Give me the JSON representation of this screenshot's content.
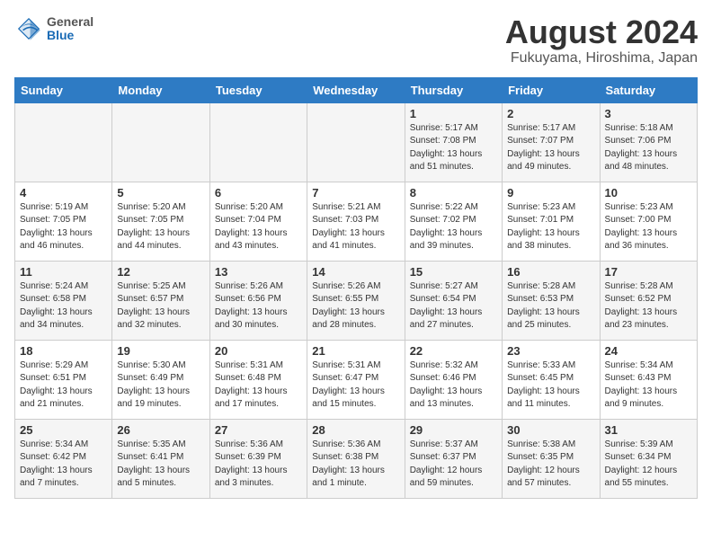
{
  "header": {
    "logo_general": "General",
    "logo_blue": "Blue",
    "month_year": "August 2024",
    "location": "Fukuyama, Hiroshima, Japan"
  },
  "days_of_week": [
    "Sunday",
    "Monday",
    "Tuesday",
    "Wednesday",
    "Thursday",
    "Friday",
    "Saturday"
  ],
  "weeks": [
    [
      {
        "day": "",
        "info": ""
      },
      {
        "day": "",
        "info": ""
      },
      {
        "day": "",
        "info": ""
      },
      {
        "day": "",
        "info": ""
      },
      {
        "day": "1",
        "info": "Sunrise: 5:17 AM\nSunset: 7:08 PM\nDaylight: 13 hours\nand 51 minutes."
      },
      {
        "day": "2",
        "info": "Sunrise: 5:17 AM\nSunset: 7:07 PM\nDaylight: 13 hours\nand 49 minutes."
      },
      {
        "day": "3",
        "info": "Sunrise: 5:18 AM\nSunset: 7:06 PM\nDaylight: 13 hours\nand 48 minutes."
      }
    ],
    [
      {
        "day": "4",
        "info": "Sunrise: 5:19 AM\nSunset: 7:05 PM\nDaylight: 13 hours\nand 46 minutes."
      },
      {
        "day": "5",
        "info": "Sunrise: 5:20 AM\nSunset: 7:05 PM\nDaylight: 13 hours\nand 44 minutes."
      },
      {
        "day": "6",
        "info": "Sunrise: 5:20 AM\nSunset: 7:04 PM\nDaylight: 13 hours\nand 43 minutes."
      },
      {
        "day": "7",
        "info": "Sunrise: 5:21 AM\nSunset: 7:03 PM\nDaylight: 13 hours\nand 41 minutes."
      },
      {
        "day": "8",
        "info": "Sunrise: 5:22 AM\nSunset: 7:02 PM\nDaylight: 13 hours\nand 39 minutes."
      },
      {
        "day": "9",
        "info": "Sunrise: 5:23 AM\nSunset: 7:01 PM\nDaylight: 13 hours\nand 38 minutes."
      },
      {
        "day": "10",
        "info": "Sunrise: 5:23 AM\nSunset: 7:00 PM\nDaylight: 13 hours\nand 36 minutes."
      }
    ],
    [
      {
        "day": "11",
        "info": "Sunrise: 5:24 AM\nSunset: 6:58 PM\nDaylight: 13 hours\nand 34 minutes."
      },
      {
        "day": "12",
        "info": "Sunrise: 5:25 AM\nSunset: 6:57 PM\nDaylight: 13 hours\nand 32 minutes."
      },
      {
        "day": "13",
        "info": "Sunrise: 5:26 AM\nSunset: 6:56 PM\nDaylight: 13 hours\nand 30 minutes."
      },
      {
        "day": "14",
        "info": "Sunrise: 5:26 AM\nSunset: 6:55 PM\nDaylight: 13 hours\nand 28 minutes."
      },
      {
        "day": "15",
        "info": "Sunrise: 5:27 AM\nSunset: 6:54 PM\nDaylight: 13 hours\nand 27 minutes."
      },
      {
        "day": "16",
        "info": "Sunrise: 5:28 AM\nSunset: 6:53 PM\nDaylight: 13 hours\nand 25 minutes."
      },
      {
        "day": "17",
        "info": "Sunrise: 5:28 AM\nSunset: 6:52 PM\nDaylight: 13 hours\nand 23 minutes."
      }
    ],
    [
      {
        "day": "18",
        "info": "Sunrise: 5:29 AM\nSunset: 6:51 PM\nDaylight: 13 hours\nand 21 minutes."
      },
      {
        "day": "19",
        "info": "Sunrise: 5:30 AM\nSunset: 6:49 PM\nDaylight: 13 hours\nand 19 minutes."
      },
      {
        "day": "20",
        "info": "Sunrise: 5:31 AM\nSunset: 6:48 PM\nDaylight: 13 hours\nand 17 minutes."
      },
      {
        "day": "21",
        "info": "Sunrise: 5:31 AM\nSunset: 6:47 PM\nDaylight: 13 hours\nand 15 minutes."
      },
      {
        "day": "22",
        "info": "Sunrise: 5:32 AM\nSunset: 6:46 PM\nDaylight: 13 hours\nand 13 minutes."
      },
      {
        "day": "23",
        "info": "Sunrise: 5:33 AM\nSunset: 6:45 PM\nDaylight: 13 hours\nand 11 minutes."
      },
      {
        "day": "24",
        "info": "Sunrise: 5:34 AM\nSunset: 6:43 PM\nDaylight: 13 hours\nand 9 minutes."
      }
    ],
    [
      {
        "day": "25",
        "info": "Sunrise: 5:34 AM\nSunset: 6:42 PM\nDaylight: 13 hours\nand 7 minutes."
      },
      {
        "day": "26",
        "info": "Sunrise: 5:35 AM\nSunset: 6:41 PM\nDaylight: 13 hours\nand 5 minutes."
      },
      {
        "day": "27",
        "info": "Sunrise: 5:36 AM\nSunset: 6:39 PM\nDaylight: 13 hours\nand 3 minutes."
      },
      {
        "day": "28",
        "info": "Sunrise: 5:36 AM\nSunset: 6:38 PM\nDaylight: 13 hours\nand 1 minute."
      },
      {
        "day": "29",
        "info": "Sunrise: 5:37 AM\nSunset: 6:37 PM\nDaylight: 12 hours\nand 59 minutes."
      },
      {
        "day": "30",
        "info": "Sunrise: 5:38 AM\nSunset: 6:35 PM\nDaylight: 12 hours\nand 57 minutes."
      },
      {
        "day": "31",
        "info": "Sunrise: 5:39 AM\nSunset: 6:34 PM\nDaylight: 12 hours\nand 55 minutes."
      }
    ]
  ]
}
